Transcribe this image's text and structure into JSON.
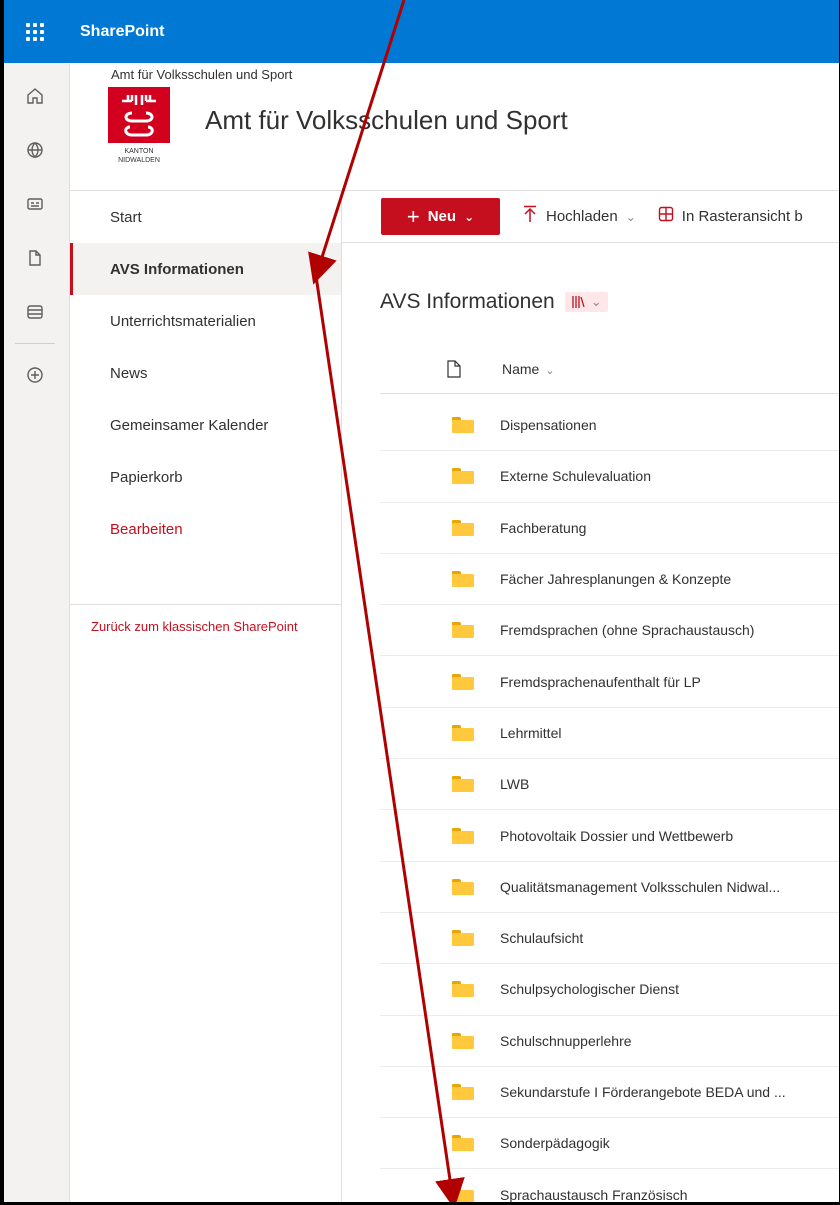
{
  "suitebar": {
    "app_name": "SharePoint"
  },
  "site": {
    "breadcrumb": "Amt für Volksschulen und Sport",
    "title": "Amt für Volksschulen und Sport",
    "logo_text_1": "KANTON",
    "logo_text_2": "NIDWALDEN"
  },
  "rail": {
    "items": [
      "home-icon",
      "globe-icon",
      "news-icon",
      "file-icon",
      "list-icon",
      "add-circle-icon"
    ]
  },
  "nav": {
    "items": [
      {
        "label": "Start"
      },
      {
        "label": "AVS Informationen",
        "selected": true
      },
      {
        "label": "Unterrichtsmaterialien"
      },
      {
        "label": "News"
      },
      {
        "label": "Gemeinsamer Kalender"
      },
      {
        "label": "Papierkorb"
      }
    ],
    "edit_label": "Bearbeiten",
    "classic_link": "Zurück zum klassischen SharePoint"
  },
  "commandbar": {
    "new_label": "Neu",
    "upload_label": "Hochladen",
    "grid_label": "In Rasteransicht b"
  },
  "library": {
    "title": "AVS Informationen",
    "column_name": "Name",
    "folders": [
      "Dispensationen",
      "Externe Schulevaluation",
      "Fachberatung",
      "Fächer Jahresplanungen & Konzepte",
      "Fremdsprachen (ohne Sprachaustausch)",
      "Fremdsprachenaufenthalt für LP",
      "Lehrmittel",
      "LWB",
      "Photovoltaik Dossier und Wettbewerb",
      "Qualitätsmanagement Volksschulen Nidwal...",
      "Schulaufsicht",
      "Schulpsychologischer Dienst",
      "Schulschnupperlehre",
      "Sekundarstufe I Förderangebote BEDA und ...",
      "Sonderpädagogik",
      "Sprachaustausch Französisch"
    ]
  },
  "colors": {
    "suitebar": "#0078d4",
    "accent": "#c50f1f",
    "folder": "#ffc83d",
    "arrow": "#b00000"
  }
}
